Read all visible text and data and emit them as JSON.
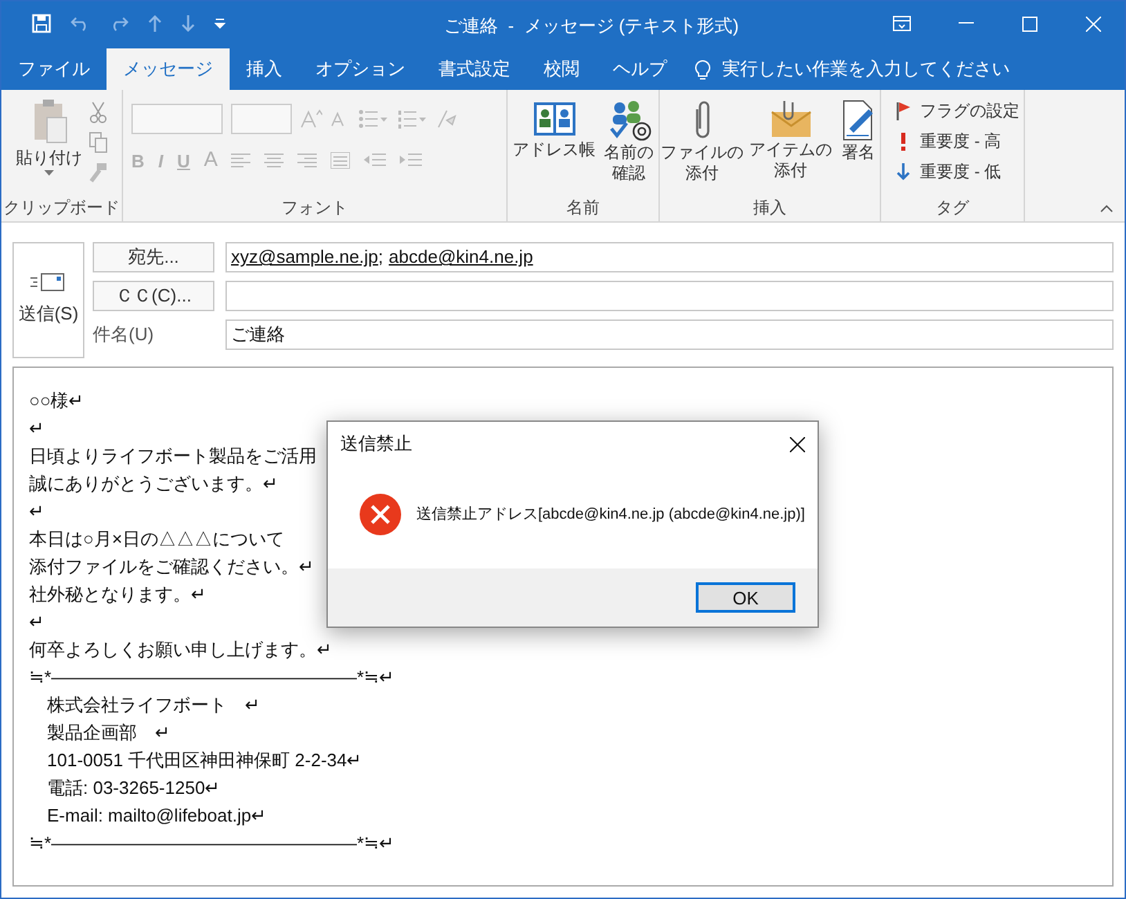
{
  "window": {
    "title": "ご連絡  -  メッセージ (テキスト形式)"
  },
  "tabs": [
    {
      "label": "ファイル",
      "selected": false
    },
    {
      "label": "メッセージ",
      "selected": true
    },
    {
      "label": "挿入",
      "selected": false
    },
    {
      "label": "オプション",
      "selected": false
    },
    {
      "label": "書式設定",
      "selected": false
    },
    {
      "label": "校閲",
      "selected": false
    },
    {
      "label": "ヘルプ",
      "selected": false
    }
  ],
  "tell_me": "実行したい作業を入力してください",
  "ribbon": {
    "clipboard": {
      "paste": "貼り付け",
      "label": "クリップボード"
    },
    "font": {
      "label": "フォント",
      "disabled": true,
      "format_buttons": [
        "B",
        "I",
        "U",
        "A"
      ]
    },
    "names": {
      "label": "名前",
      "buttons": [
        {
          "lines": [
            "アドレス帳"
          ],
          "kind": "book"
        },
        {
          "lines": [
            "名前の",
            "確認"
          ],
          "kind": "people"
        }
      ]
    },
    "insert": {
      "label": "挿入",
      "buttons": [
        {
          "lines": [
            "ファイルの",
            "添付"
          ],
          "kind": "clip"
        },
        {
          "lines": [
            "アイテムの",
            "添付"
          ],
          "kind": "envelope"
        },
        {
          "lines": [
            "署名"
          ],
          "kind": "signature"
        }
      ]
    },
    "tags": {
      "label": "タグ",
      "items": [
        {
          "label": "フラグの設定",
          "kind": "flag"
        },
        {
          "label": "重要度 - 高",
          "kind": "high"
        },
        {
          "label": "重要度 - 低",
          "kind": "low"
        }
      ]
    }
  },
  "header": {
    "send": "送信(S)",
    "to_button": "宛先...",
    "recipients": [
      "xyz@sample.ne.jp",
      "abcde@kin4.ne.jp"
    ],
    "separator": ";",
    "cc_button": "ＣＣ(C)...",
    "subject_label": "件名(U)",
    "subject": "ご連絡"
  },
  "body": {
    "lines": [
      "○○様↵",
      "↵",
      "日頃よりライフボート製品をご活用",
      "誠にありがとうございます。↵",
      "↵",
      "本日は○月×日の△△△について",
      "添付ファイルをご確認ください。↵",
      "社外秘となります。↵",
      "↵",
      "何卒よろしくお願い申し上げます。↵",
      "≒*―――――――――――――――――*≒↵",
      "　株式会社ライフボート　↵",
      "　製品企画部　↵",
      "　101-0051 千代田区神田神保町 2-2-34↵",
      "　電話: 03-3265-1250↵",
      "　E-mail: mailto@lifeboat.jp↵",
      "≒*―――――――――――――――――*≒↵"
    ]
  },
  "dialog": {
    "title": "送信禁止",
    "message": "送信禁止アドレス[abcde@kin4.ne.jp (abcde@kin4.ne.jp)]",
    "ok": "OK"
  }
}
